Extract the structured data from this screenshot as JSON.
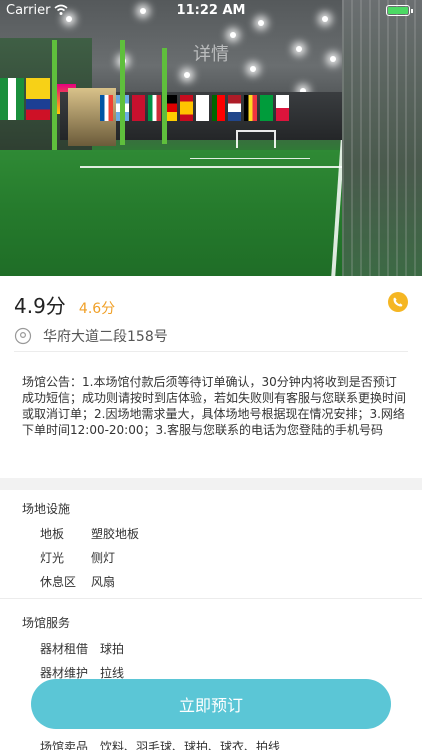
{
  "status_bar": {
    "carrier": "Carrier",
    "time": "11:22 AM",
    "battery_color": "#4cd964"
  },
  "nav": {
    "title": "详情"
  },
  "venue": {
    "rating_main": "4.9分",
    "rating_sub": "4.6分",
    "rating_sub_color": "#f0a028",
    "address": "华府大道二段158号",
    "phone_icon": "phone-icon",
    "phone_color": "#f5b623",
    "location_icon": "location-pin-icon"
  },
  "notice": {
    "text": "场馆公告：1.本场馆付款后须等待订单确认，30分钟内将收到是否预订成功短信；成功则请按时到店体验，若如失败则有客服与您联系更换时间或取消订单；2.因场地需求量大，具体场地号根据现在情况安排；3.网络下单时间12:00-20:00；3.客服与您联系的电话为您登陆的手机号码"
  },
  "facilities": {
    "title": "场地设施",
    "items": [
      {
        "key": "地板",
        "value": "塑胶地板"
      },
      {
        "key": "灯光",
        "value": "侧灯"
      },
      {
        "key": "休息区",
        "value": "风扇"
      }
    ]
  },
  "services": {
    "title": "场馆服务",
    "items": [
      {
        "key": "器材租借",
        "value": "球拍"
      },
      {
        "key": "器材维护",
        "value": "拉线"
      },
      {
        "key": "场馆卖品",
        "value": "饮料、羽毛球、球拍、球衣、拍线"
      }
    ]
  },
  "actions": {
    "book_label": "立即预订",
    "book_color": "#5bc6d6"
  }
}
